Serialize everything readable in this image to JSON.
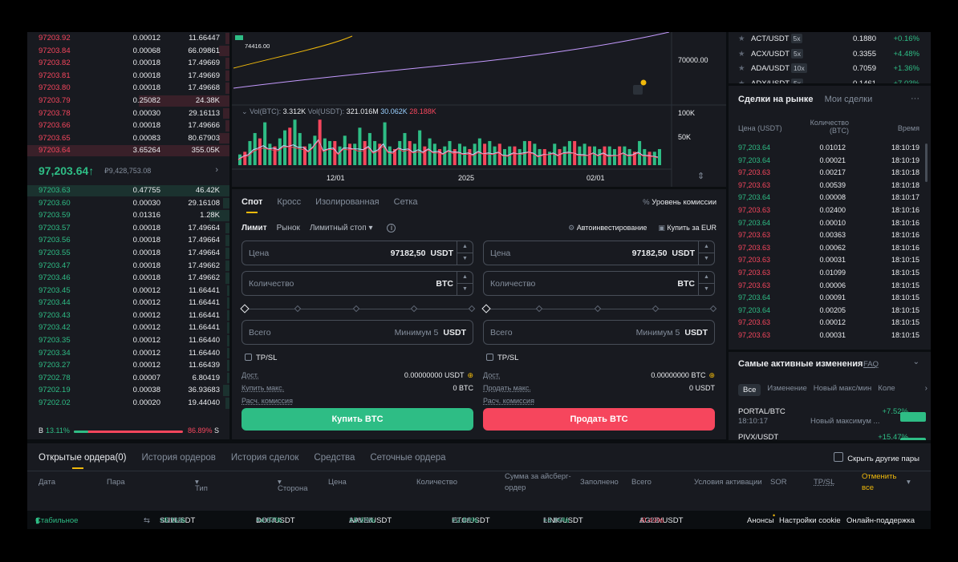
{
  "order_book": {
    "asks": [
      {
        "price": "97203.92",
        "qty": "0.00012",
        "total": "11.66447"
      },
      {
        "price": "97203.84",
        "qty": "0.00068",
        "total": "66.09861"
      },
      {
        "price": "97203.82",
        "qty": "0.00018",
        "total": "17.49669"
      },
      {
        "price": "97203.81",
        "qty": "0.00018",
        "total": "17.49669"
      },
      {
        "price": "97203.80",
        "qty": "0.00018",
        "total": "17.49668"
      },
      {
        "price": "97203.79",
        "qty": "0.25082",
        "total": "24.38K"
      },
      {
        "price": "97203.78",
        "qty": "0.00030",
        "total": "29.16113"
      },
      {
        "price": "97203.66",
        "qty": "0.00018",
        "total": "17.49666"
      },
      {
        "price": "97203.65",
        "qty": "0.00083",
        "total": "80.67903"
      },
      {
        "price": "97203.64",
        "qty": "3.65264",
        "total": "355.05K"
      }
    ],
    "ask_depth": [
      0.02,
      0.05,
      0.02,
      0.02,
      0.02,
      0.45,
      0.03,
      0.02,
      0.05,
      1.0
    ],
    "last_price": "97,203.64",
    "last_arrow": "↑",
    "last_fiat": "₽9,428,753.08",
    "bids": [
      {
        "price": "97203.63",
        "qty": "0.47755",
        "total": "46.42K"
      },
      {
        "price": "97203.60",
        "qty": "0.00030",
        "total": "29.16108"
      },
      {
        "price": "97203.59",
        "qty": "0.01316",
        "total": "1.28K"
      },
      {
        "price": "97203.57",
        "qty": "0.00018",
        "total": "17.49664"
      },
      {
        "price": "97203.56",
        "qty": "0.00018",
        "total": "17.49664"
      },
      {
        "price": "97203.55",
        "qty": "0.00018",
        "total": "17.49664"
      },
      {
        "price": "97203.47",
        "qty": "0.00018",
        "total": "17.49662"
      },
      {
        "price": "97203.46",
        "qty": "0.00018",
        "total": "17.49662"
      },
      {
        "price": "97203.45",
        "qty": "0.00012",
        "total": "11.66441"
      },
      {
        "price": "97203.44",
        "qty": "0.00012",
        "total": "11.66441"
      },
      {
        "price": "97203.43",
        "qty": "0.00012",
        "total": "11.66441"
      },
      {
        "price": "97203.42",
        "qty": "0.00012",
        "total": "11.66441"
      },
      {
        "price": "97203.35",
        "qty": "0.00012",
        "total": "11.66440"
      },
      {
        "price": "97203.34",
        "qty": "0.00012",
        "total": "11.66440"
      },
      {
        "price": "97203.27",
        "qty": "0.00012",
        "total": "11.66439"
      },
      {
        "price": "97202.78",
        "qty": "0.00007",
        "total": "6.80419"
      },
      {
        "price": "97202.19",
        "qty": "0.00038",
        "total": "36.93683"
      },
      {
        "price": "97202.02",
        "qty": "0.00020",
        "total": "19.44040"
      }
    ],
    "bid_depth": [
      1.0,
      0.03,
      0.1,
      0.02,
      0.02,
      0.02,
      0.02,
      0.02,
      0.01,
      0.01,
      0.01,
      0.01,
      0.01,
      0.01,
      0.01,
      0.01,
      0.03,
      0.02
    ],
    "buy_label": "B",
    "buy_pct": "13.11%",
    "buy_fraction": 0.1311,
    "sell_pct": "86.89%",
    "sell_label": "S"
  },
  "chart": {
    "marker_price": "74416.00",
    "price_tick": "70000.00",
    "vol_btc_label": "Vol(BTC):",
    "vol_btc": "3.312K",
    "vol_usdt_label": "Vol(USDT):",
    "vol_usdt": "321.016M",
    "ma1": "30.062K",
    "ma2": "28.188K",
    "vol_ticks": [
      "100K",
      "50K"
    ],
    "x_ticks": [
      "12/01",
      "2025",
      "02/01"
    ]
  },
  "chart_data": {
    "type": "bar",
    "title": "",
    "series": [
      {
        "values": [
          20,
          30,
          45,
          60,
          55,
          80,
          40,
          70,
          50,
          65,
          45,
          85,
          60,
          75,
          40,
          55,
          70,
          50,
          45,
          60,
          35,
          55,
          65,
          40,
          70,
          50,
          60,
          45,
          55,
          80,
          35,
          50,
          45,
          60,
          55,
          40,
          65,
          45,
          50,
          40,
          55,
          35,
          45,
          50,
          40,
          35,
          45,
          40,
          50,
          30,
          45,
          35,
          40,
          30,
          35,
          40,
          30,
          45,
          35,
          40,
          30,
          35,
          25,
          40,
          30,
          35,
          45,
          30,
          35,
          40,
          25,
          35,
          30,
          40,
          35,
          30,
          25,
          35,
          30,
          40,
          45,
          30,
          35,
          25,
          30
        ]
      },
      {
        "values": [
          15,
          25,
          20,
          35,
          50,
          40,
          60,
          35,
          45,
          55,
          70,
          40,
          50,
          35,
          45,
          60,
          85,
          40,
          55,
          45,
          35,
          50,
          40,
          60,
          30,
          45,
          55,
          35,
          40,
          50,
          45,
          30,
          60,
          35,
          45,
          40,
          30,
          35,
          50,
          40,
          30,
          35,
          45,
          30,
          40,
          35,
          30,
          25,
          35,
          40,
          30,
          35,
          40,
          30,
          25,
          35,
          40,
          30,
          45,
          35,
          25,
          30,
          40,
          35,
          30,
          40,
          35,
          45,
          30,
          25,
          35,
          40,
          30,
          35,
          25,
          30,
          35,
          40,
          30,
          25,
          35,
          30,
          25,
          30,
          20
        ]
      }
    ],
    "ylim": [
      0,
      130
    ]
  },
  "form": {
    "tabs": [
      "Спот",
      "Кросс",
      "Изолированная",
      "Сетка"
    ],
    "fee_label": "Уровень комиссии",
    "order_types": [
      "Лимит",
      "Рынок",
      "Лимитный стоп"
    ],
    "auto_invest": "Автоинвестирование",
    "buy_eur": "Купить за EUR",
    "buy": {
      "price_label": "Цена",
      "price": "97182,50",
      "price_unit": "USDT",
      "qty_label": "Количество",
      "qty_unit": "BTC",
      "total_label": "Всего",
      "total_hint": "Минимум 5",
      "total_unit": "USDT",
      "tpsl": "TP/SL",
      "avail_label": "Дост.",
      "avail": "0.00000000 USDT",
      "max_label": "Купить макс.",
      "max": "0 BTC",
      "fee_label": "Расч. комиссия",
      "button": "Купить BTC"
    },
    "sell": {
      "price_label": "Цена",
      "price": "97182,50",
      "price_unit": "USDT",
      "qty_label": "Количество",
      "qty_unit": "BTC",
      "total_label": "Всего",
      "total_hint": "Минимум 5",
      "total_unit": "USDT",
      "tpsl": "TP/SL",
      "avail_label": "Дост.",
      "avail": "0.00000000 BTC",
      "max_label": "Продать макс.",
      "max": "0 USDT",
      "fee_label": "Расч. комиссия",
      "button": "Продать BTC"
    }
  },
  "pairs": [
    {
      "name": "ACT/USDT",
      "lev": "5x",
      "price": "0.1880",
      "change": "+0.16%"
    },
    {
      "name": "ACX/USDT",
      "lev": "5x",
      "price": "0.3355",
      "change": "+4.48%"
    },
    {
      "name": "ADA/USDT",
      "lev": "10x",
      "price": "0.7059",
      "change": "+1.36%"
    },
    {
      "name": "ADX/USDT",
      "lev": "5x",
      "price": "0.1461",
      "change": "+7.03%"
    }
  ],
  "trades": {
    "tab_market": "Сделки на рынке",
    "tab_mine": "Мои сделки",
    "more": "···",
    "col_price": "Цена (USDT)",
    "col_qty": "Количество",
    "col_qty_unit": "(BTC)",
    "col_time": "Время",
    "rows": [
      {
        "p": "97,203.64",
        "q": "0.01012",
        "t": "18:10:19",
        "side": "buy"
      },
      {
        "p": "97,203.64",
        "q": "0.00021",
        "t": "18:10:19",
        "side": "buy"
      },
      {
        "p": "97,203.63",
        "q": "0.00217",
        "t": "18:10:18",
        "side": "sell"
      },
      {
        "p": "97,203.63",
        "q": "0.00539",
        "t": "18:10:18",
        "side": "sell"
      },
      {
        "p": "97,203.64",
        "q": "0.00008",
        "t": "18:10:17",
        "side": "buy"
      },
      {
        "p": "97,203.63",
        "q": "0.02400",
        "t": "18:10:16",
        "side": "sell"
      },
      {
        "p": "97,203.64",
        "q": "0.00010",
        "t": "18:10:16",
        "side": "buy"
      },
      {
        "p": "97,203.63",
        "q": "0.00363",
        "t": "18:10:16",
        "side": "sell"
      },
      {
        "p": "97,203.63",
        "q": "0.00062",
        "t": "18:10:16",
        "side": "sell"
      },
      {
        "p": "97,203.63",
        "q": "0.00031",
        "t": "18:10:15",
        "side": "sell"
      },
      {
        "p": "97,203.63",
        "q": "0.01099",
        "t": "18:10:15",
        "side": "sell"
      },
      {
        "p": "97,203.63",
        "q": "0.00006",
        "t": "18:10:15",
        "side": "sell"
      },
      {
        "p": "97,203.64",
        "q": "0.00091",
        "t": "18:10:15",
        "side": "buy"
      },
      {
        "p": "97,203.64",
        "q": "0.00205",
        "t": "18:10:15",
        "side": "buy"
      },
      {
        "p": "97,203.63",
        "q": "0.00012",
        "t": "18:10:15",
        "side": "sell"
      },
      {
        "p": "97,203.63",
        "q": "0.00031",
        "t": "18:10:15",
        "side": "sell"
      }
    ]
  },
  "movers": {
    "title": "Самые активные изменения",
    "faq": "FAQ",
    "tabs": [
      "Все",
      "Изменение",
      "Новый макс/мин",
      "Коле"
    ],
    "items": [
      {
        "pair": "PORTAL/BTC",
        "time": "18:10:17",
        "desc": "Новый максимум ...",
        "change": "+7.52%"
      },
      {
        "pair": "PIVX/USDT",
        "time": "",
        "desc": "",
        "change": "+15.47%"
      }
    ]
  },
  "orders": {
    "tabs": [
      "Открытые ордера(0)",
      "История ордеров",
      "История сделок",
      "Средства",
      "Сеточные ордера"
    ],
    "hide_pairs": "Скрыть другие пары",
    "cols": [
      "Дата",
      "Пара",
      "Тип",
      "Сторона",
      "Цена",
      "Количество",
      "Сумма за айсберг-ордер",
      "Заполнено",
      "Всего",
      "Условия активации",
      "SOR",
      "TP/SL",
      "Отменить все"
    ]
  },
  "footer": {
    "conn": "Стабильное соединение",
    "ticker": [
      {
        "pair": "SUI/USDT",
        "ch": "+5.11%",
        "p": "3.1163",
        "up": true
      },
      {
        "pair": "DOT/USDT",
        "ch": "+4.87%",
        "p": "4.804",
        "up": true
      },
      {
        "pair": "AAVE/USDT",
        "ch": "+5.68%",
        "p": "248.66",
        "up": true
      },
      {
        "pair": "ETC/USDT",
        "ch": "+2.93%",
        "p": "20.40",
        "up": true
      },
      {
        "pair": "LINK/USDT",
        "ch": "+4.09%",
        "p": "18.83",
        "up": true
      },
      {
        "pair": "AGLD/USDT",
        "ch": "-0.49%",
        "p": "1.223",
        "up": false
      }
    ],
    "links": [
      "Анонсы",
      "Настройки cookie",
      "Онлайн-поддержка"
    ]
  }
}
